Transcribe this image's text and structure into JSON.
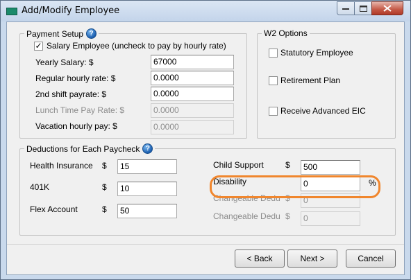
{
  "window": {
    "title": "Add/Modify Employee"
  },
  "payment_setup": {
    "legend": "Payment Setup",
    "salary_checkbox": {
      "label": "Salary Employee (uncheck to pay by hourly rate)",
      "checked": true
    },
    "fields": [
      {
        "label": "Yearly Salary: $",
        "value": "67000",
        "enabled": true
      },
      {
        "label": "Regular hourly rate: $",
        "value": "0.0000",
        "enabled": true
      },
      {
        "label": "2nd shift payrate: $",
        "value": "0.0000",
        "enabled": true
      },
      {
        "label": "Lunch Time Pay Rate: $",
        "value": "0.0000",
        "enabled": false
      },
      {
        "label": "Vacation hourly pay: $",
        "value": "0.0000",
        "enabled": false
      }
    ]
  },
  "w2_options": {
    "legend": "W2 Options",
    "items": [
      {
        "label": "Statutory Employee",
        "checked": false
      },
      {
        "label": "Retirement Plan",
        "checked": false
      },
      {
        "label": "Receive Advanced EIC",
        "checked": false
      }
    ]
  },
  "deductions": {
    "legend": "Deductions for Each Paycheck",
    "currency": "$",
    "percent": "%",
    "left": [
      {
        "label": "Health Insurance",
        "value": "15"
      },
      {
        "label": "401K",
        "value": "10"
      },
      {
        "label": "Flex Account",
        "value": "50"
      }
    ],
    "right": [
      {
        "label": "Child Support",
        "value": "500",
        "enabled": true,
        "highlighted": true
      },
      {
        "label": "Disability",
        "value": "0",
        "enabled": true
      },
      {
        "label": "Changeable Dedu",
        "value": "0",
        "enabled": false
      },
      {
        "label": "Changeable Dedu",
        "value": "0",
        "enabled": false
      }
    ]
  },
  "buttons": {
    "back": {
      "label": "< Back",
      "mnemonic": "B"
    },
    "next": {
      "label": "Next >",
      "mnemonic": "N"
    },
    "cancel": {
      "label": "Cancel"
    }
  },
  "colors": {
    "highlight": "#f0862d",
    "help_icon": "#1c5fb0"
  }
}
